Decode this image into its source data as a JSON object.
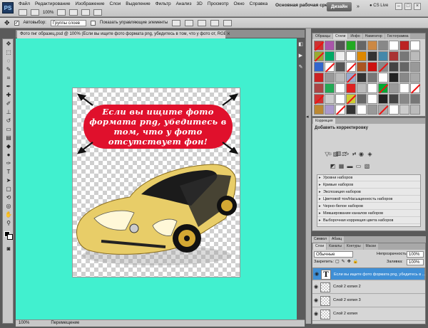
{
  "app": {
    "logo": "PS",
    "menu": [
      "Файл",
      "Редактирование",
      "Изображение",
      "Слои",
      "Выделение",
      "Фильтр",
      "Анализ",
      "3D",
      "Просмотр",
      "Окно",
      "Справка"
    ],
    "zoom": "100%",
    "workspace": "Основная рабочая среда",
    "design_button": "Дизайн",
    "cs_live": "CS Live"
  },
  "options": {
    "autoselect_label": "Автовыбор:",
    "autoselect_value": "Группы слоев",
    "show_controls_label": "Показать управляющие элементы"
  },
  "document": {
    "tab_title": "Фото пнг образец.psd @ 100% (Если вы ищите фото формата png, убедитесь в том, что у фото от, RGB/8*)",
    "pill_text": "Если вы ищите фото формата png, убедитесь в том, что у фото отсутствует фон!"
  },
  "status": {
    "zoom": "100%",
    "mode": "Перемещение"
  },
  "styles_panel": {
    "tabs": [
      "Образцы",
      "Стили",
      "Инфо",
      "Навигатор",
      "Гистограмма"
    ],
    "active_tab": "Стили"
  },
  "corrections_panel": {
    "tab": "Коррекция",
    "title": "Добавить корректировку",
    "presets": [
      "Уровни наборов",
      "Кривые наборов",
      "Экспозиция наборов",
      "Цветовой тон/Насыщенность наборов",
      "Черно-белое наборов",
      "Микширование каналов наборов",
      "Выборочная коррекция цвета наборов"
    ]
  },
  "symbol_tabs": [
    "Символ",
    "Абзац"
  ],
  "layers_panel": {
    "tabs": [
      "Слои",
      "Каналы",
      "Контуры",
      "Маски"
    ],
    "blend_mode": "Обычные",
    "opacity_label": "Непрозрачность:",
    "opacity_value": "100%",
    "lock_label": "Закрепить:",
    "fill_label": "Заливка:",
    "fill_value": "100%",
    "layers": [
      {
        "name": "Если вы ищите фото формата png, убедитесь в ...",
        "type": "text",
        "selected": true
      },
      {
        "name": "Слой 2 копия 2",
        "type": "raster",
        "selected": false
      },
      {
        "name": "Слой 2 копия 3",
        "type": "raster",
        "selected": false
      },
      {
        "name": "Слой 2 копия",
        "type": "raster",
        "selected": false
      }
    ]
  },
  "colors": {
    "canvas_bg": "#41f0cf",
    "pill_red": "#e0102c",
    "selection_blue": "#3f8fd6"
  }
}
